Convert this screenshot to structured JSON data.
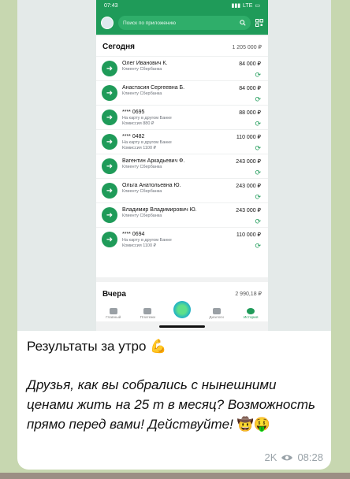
{
  "phone": {
    "time": "07:43",
    "network": "LTE",
    "search_placeholder": "Поиск по приложению",
    "today": {
      "title": "Сегодня",
      "total": "1 205 000 ₽",
      "transactions": [
        {
          "name": "Олег Иванович К.",
          "sub1": "Клиенту Сбербанка",
          "sub2": "",
          "amount": "84 000 ₽"
        },
        {
          "name": "Анастасия Сергеевна Б.",
          "sub1": "Клиенту Сбербанка",
          "sub2": "",
          "amount": "84 000 ₽"
        },
        {
          "name": "**** 0695",
          "sub1": "На карту в другом Банке",
          "sub2": "Комиссия 880 ₽",
          "amount": "88 000 ₽"
        },
        {
          "name": "**** 0482",
          "sub1": "На карту в другом Банке",
          "sub2": "Комиссия 1100 ₽",
          "amount": "110 000 ₽"
        },
        {
          "name": "Вагентин Аркадьевич Ф.",
          "sub1": "Клиенту Сбербанка",
          "sub2": "",
          "amount": "243 000 ₽"
        },
        {
          "name": "Ольга Анатольевна Ю.",
          "sub1": "Клиенту Сбербанка",
          "sub2": "",
          "amount": "243 000 ₽"
        },
        {
          "name": "Владимир Владимирович Ю.",
          "sub1": "Клиенту Сбербанка",
          "sub2": "",
          "amount": "243 000 ₽"
        },
        {
          "name": "**** 0694",
          "sub1": "На карту в другом Банке",
          "sub2": "Комиссия 1100 ₽",
          "amount": "110 000 ₽"
        }
      ]
    },
    "yesterday": {
      "title": "Вчера",
      "total": "2 990,18 ₽"
    },
    "tabs": [
      "Главный",
      "Платежи",
      "",
      "Диалоги",
      "История"
    ]
  },
  "message": {
    "title": "Результаты за утро",
    "title_emoji": "💪",
    "body": "Друзья, как вы собрались с нынешними ценами жить на 25 т в месяц? Возможность прямо перед вами! Действуйте!",
    "body_emoji": "🤠🤑",
    "views": "2K",
    "time": "08:28"
  }
}
